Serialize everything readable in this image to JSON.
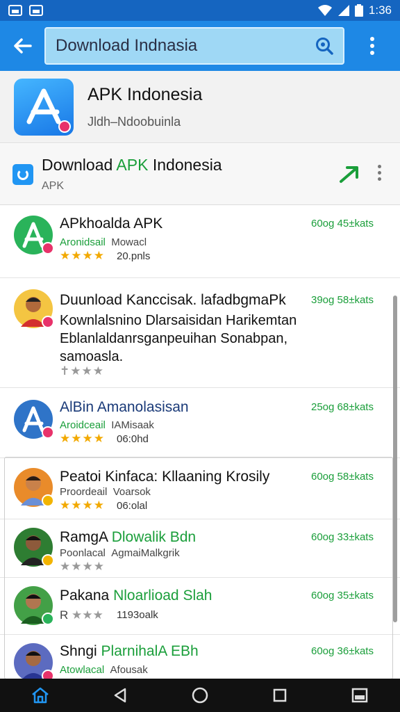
{
  "status_bar": {
    "time": "1:36"
  },
  "toolbar": {
    "search_value": "Download Indnasia"
  },
  "header_app": {
    "title": "APK Indonesia",
    "subtitle": "Jldh–Ndoobuinla"
  },
  "banner": {
    "title_part1": "Download ",
    "title_green": "APK",
    "title_part2": " Indonesia",
    "subtitle": "APK"
  },
  "items": [
    {
      "title": "APkhoalda APK",
      "size": "60og 45±kats",
      "sub_left": "Aronidsail",
      "sub_right": "Mowacl",
      "rating": 4,
      "meta": "20.pnls",
      "avatar_color": "#2ab35a",
      "badge_color": "#e8326a"
    },
    {
      "title": "Duunload Kanccisak. lafadbgmaPk",
      "desc": "Kownlalsnino Dlarsaisidan Harikemtan Eblanlaldanrsganpeuihan Sonabpan, samoasla.",
      "size": "39og 58±kats",
      "rating": 0,
      "avatar_color": "#f4c542",
      "badge_color": "#e8326a"
    },
    {
      "title": "AlBin Amanolasisan",
      "size": "25og 68±kats",
      "sub_left": "Aroidceail",
      "sub_right": "IAMisaak",
      "rating": 4,
      "meta": "06:0hd",
      "avatar_color": "#2f74c8",
      "badge_color": "#e8326a"
    },
    {
      "title": "Peatoi Kinfaca: Kllaaning Krosily",
      "size": "60og 58±kats",
      "sub_left": "Proordeail",
      "sub_right": "Voarsok",
      "rating": 4,
      "meta": "06:olal",
      "avatar_color": "#e98b2a",
      "badge_color": "#f2b400"
    },
    {
      "title_part1": "RamgA ",
      "title_green": "Dlowalik Bdn",
      "size": "60og 33±kats",
      "sub_left": "Poonlacal",
      "sub_right": "AgmaiMalkgrik",
      "rating": 0,
      "avatar_color": "#2e7d32",
      "badge_color": "#f2b400"
    },
    {
      "title_part1": "Pakana ",
      "title_green": "Nloarlioad Slah",
      "size": "60og 35±kats",
      "sub_left": "R",
      "meta": "1193oalk",
      "rating": 0,
      "avatar_color": "#43a047",
      "badge_color": "#2ab35a"
    },
    {
      "title_part1": "Shngi ",
      "title_green": "PlarnihalA EBh",
      "size": "60og 36±kats",
      "sub_left": "Atowlacal",
      "sub_right": "Afousak",
      "avatar_color": "#5c6bc0",
      "badge_color": "#e8326a"
    }
  ]
}
